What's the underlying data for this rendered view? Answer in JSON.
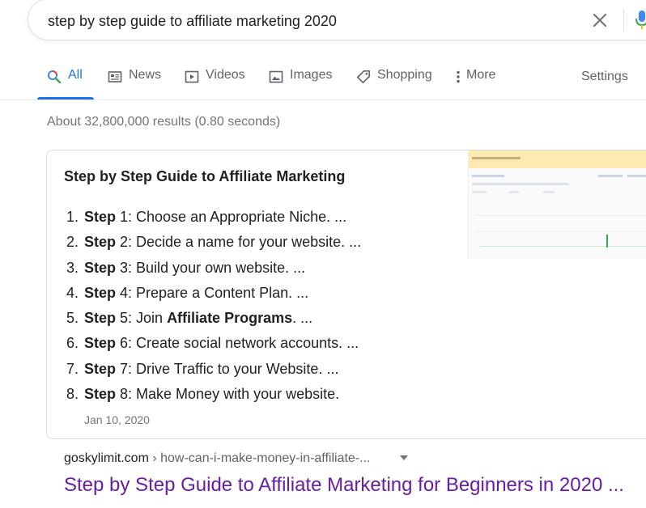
{
  "search": {
    "query": "step by step guide to affiliate marketing 2020"
  },
  "tabs": [
    {
      "label": "All",
      "icon": "search-icon",
      "active": true
    },
    {
      "label": "News",
      "icon": "news-icon"
    },
    {
      "label": "Videos",
      "icon": "video-icon"
    },
    {
      "label": "Images",
      "icon": "image-icon"
    },
    {
      "label": "Shopping",
      "icon": "tag-icon"
    },
    {
      "label": "More",
      "icon": "more-vert-icon"
    }
  ],
  "settings_label": "Settings",
  "result_stats": "About 32,800,000 results (0.80 seconds)",
  "snippet": {
    "title": "Step by Step Guide to Affiliate Marketing",
    "steps": [
      {
        "num": "1.",
        "bold": "Step",
        "text": " 1: Choose an Appropriate Niche. ..."
      },
      {
        "num": "2.",
        "bold": "Step",
        "text": " 2: Decide a name for your website. ..."
      },
      {
        "num": "3.",
        "bold": "Step",
        "text": " 3: Build your own website. ..."
      },
      {
        "num": "4.",
        "bold": "Step",
        "text": " 4: Prepare a Content Plan. ..."
      },
      {
        "num": "5.",
        "bold": "Step",
        "text": " 5: Join ",
        "bold2": "Affiliate Programs",
        "text2": ". ..."
      },
      {
        "num": "6.",
        "bold": "Step",
        "text": " 6: Create social network accounts. ..."
      },
      {
        "num": "7.",
        "bold": "Step",
        "text": " 7: Drive Traffic to your Website. ..."
      },
      {
        "num": "8.",
        "bold": "Step",
        "text": " 8: Make Money with your website."
      }
    ],
    "date": "Jan 10, 2020"
  },
  "result": {
    "site": "goskylimit.com",
    "path": " › how-can-i-make-money-in-affiliate-...",
    "title": "Step by Step Guide to Affiliate Marketing for Beginners in 2020 ..."
  },
  "colors": {
    "accent": "#1a73e8",
    "visited_link": "#681da8",
    "muted": "#70757a"
  }
}
